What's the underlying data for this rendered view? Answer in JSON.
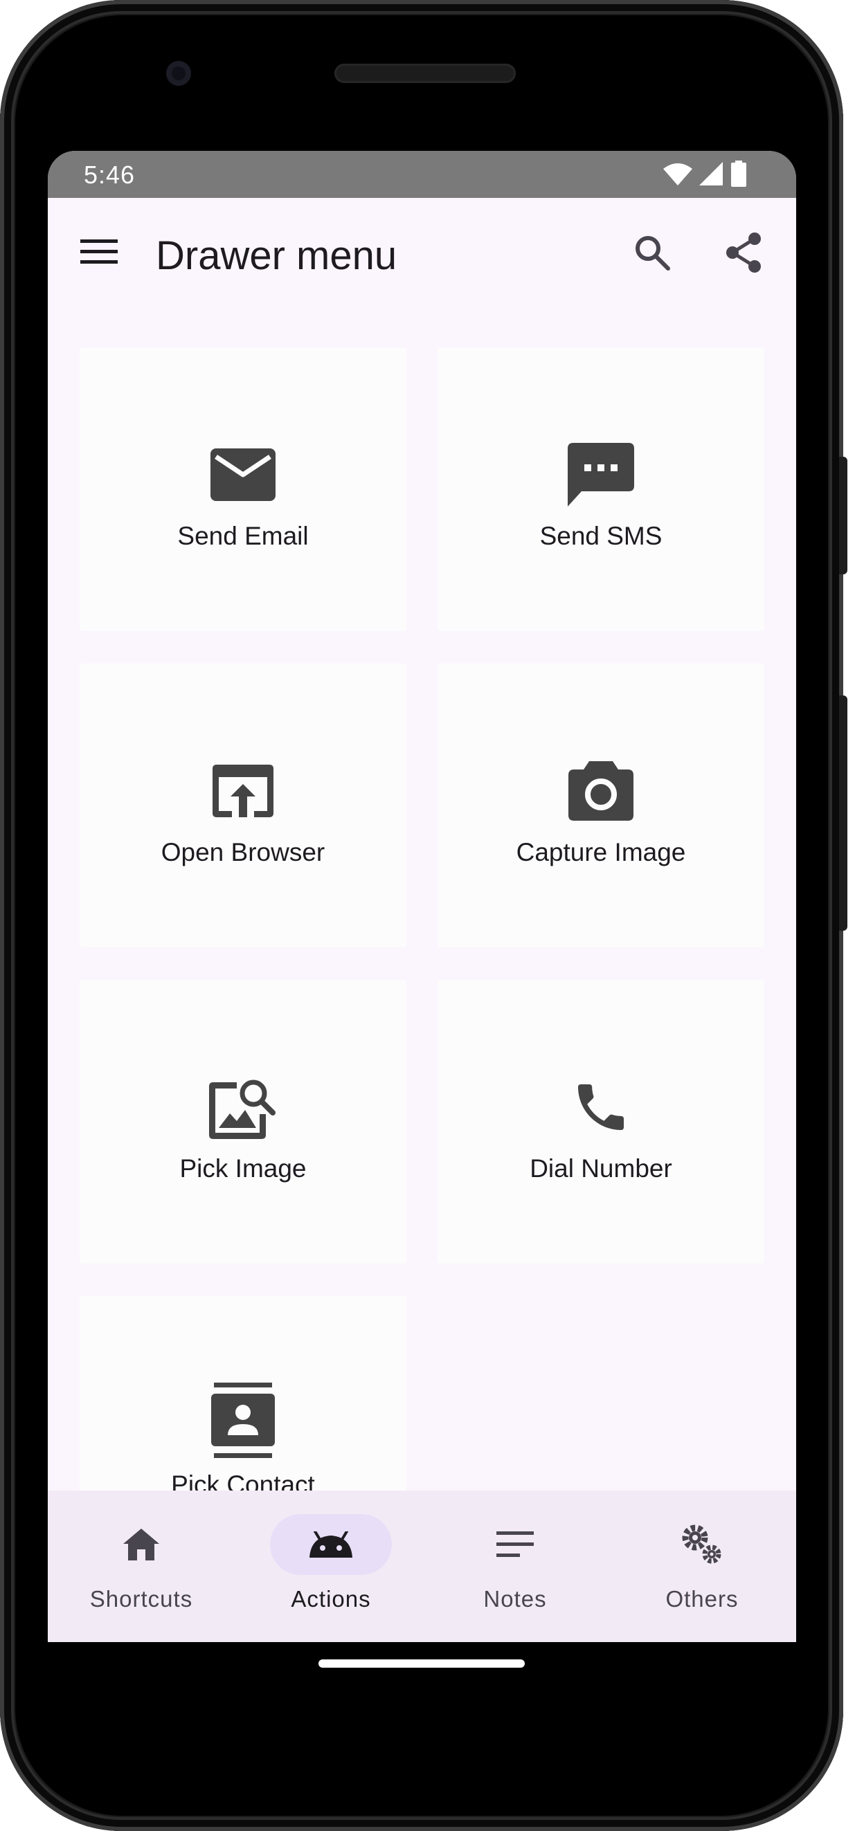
{
  "status_bar": {
    "time": "5:46",
    "icons": [
      "wifi-icon",
      "signal-icon",
      "battery-icon"
    ]
  },
  "app_bar": {
    "title": "Drawer menu",
    "icons": [
      "menu-icon",
      "search-icon",
      "share-icon"
    ]
  },
  "actions": [
    {
      "label": "Send Email",
      "icon": "email-icon"
    },
    {
      "label": "Send SMS",
      "icon": "sms-icon"
    },
    {
      "label": "Open Browser",
      "icon": "open-browser-icon"
    },
    {
      "label": "Capture Image",
      "icon": "camera-icon"
    },
    {
      "label": "Pick Image",
      "icon": "image-search-icon"
    },
    {
      "label": "Dial Number",
      "icon": "phone-icon"
    },
    {
      "label": "Pick Contact",
      "icon": "contacts-icon"
    }
  ],
  "bottom_nav": {
    "items": [
      {
        "label": "Shortcuts",
        "icon": "home-icon",
        "active": false
      },
      {
        "label": "Actions",
        "icon": "android-icon",
        "active": true
      },
      {
        "label": "Notes",
        "icon": "notes-icon",
        "active": false
      },
      {
        "label": "Others",
        "icon": "settings-gears-icon",
        "active": false
      }
    ]
  },
  "colors": {
    "background": "#fbf5fd",
    "card": "#fdfcfd",
    "status_bar": "#7a7a7a",
    "bottom_nav": "#f2ebf5",
    "active_indicator": "#e8def8",
    "icon": "#444444",
    "text": "#1d1b20"
  }
}
